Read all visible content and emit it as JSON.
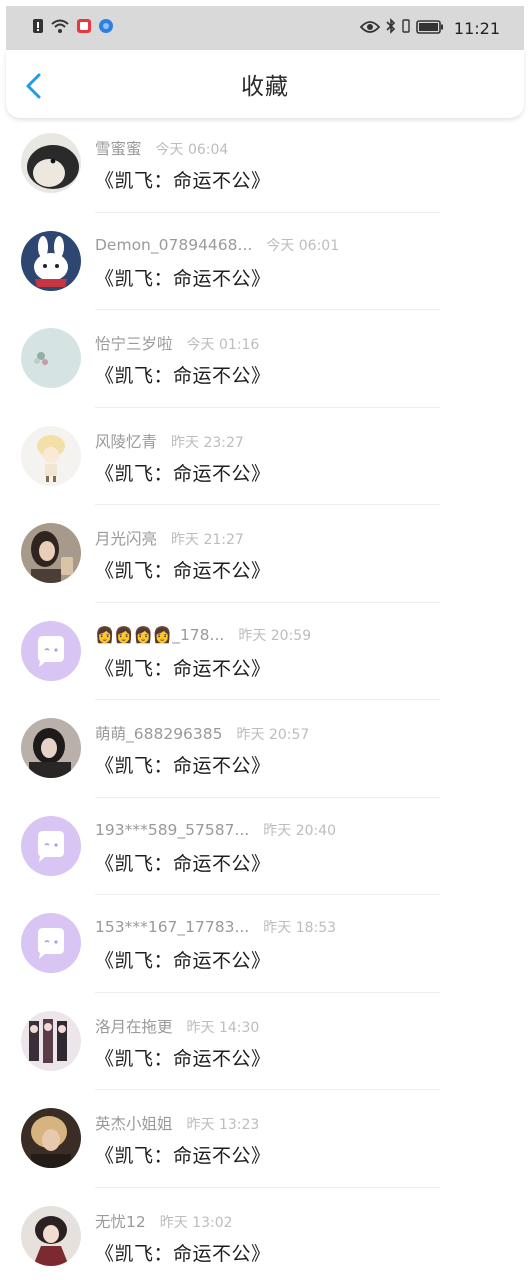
{
  "status_bar": {
    "time": "11:21",
    "left_icons": [
      "alert-icon",
      "wifi-icon",
      "app-notification-icon",
      "browser-icon"
    ],
    "right_icons": [
      "eye-icon",
      "bluetooth-icon",
      "battery-icon"
    ]
  },
  "header": {
    "title": "收藏",
    "back_icon": "chevron-left-icon"
  },
  "accent_color": "#1e9be9",
  "favorites": [
    {
      "name": "雪蜜蜜",
      "time": "今天 06:04",
      "text": "《凯飞：命运不公》",
      "avatar": "plush-toy"
    },
    {
      "name": "Demon_07894468...",
      "time": "今天 06:01",
      "text": "《凯飞：命运不公》",
      "avatar": "bunny"
    },
    {
      "name": "怡宁三岁啦",
      "time": "今天 01:16",
      "text": "《凯飞：命运不公》",
      "avatar": "flower"
    },
    {
      "name": "风陵忆青",
      "time": "昨天 23:27",
      "text": "《凯飞：命运不公》",
      "avatar": "cartoon-girl"
    },
    {
      "name": "月光闪亮",
      "time": "昨天 21:27",
      "text": "《凯飞：命运不公》",
      "avatar": "photo-girl"
    },
    {
      "name": "👩👩👩👩_178...",
      "time": "昨天 20:59",
      "text": "《凯飞：命运不公》",
      "avatar": "default-chat"
    },
    {
      "name": "萌萌_688296385",
      "time": "昨天 20:57",
      "text": "《凯飞：命运不公》",
      "avatar": "photo-dark"
    },
    {
      "name": "193***589_57587...",
      "time": "昨天 20:40",
      "text": "《凯飞：命运不公》",
      "avatar": "default-chat"
    },
    {
      "name": "153***167_17783...",
      "time": "昨天 18:53",
      "text": "《凯飞：命运不公》",
      "avatar": "default-chat"
    },
    {
      "name": "洛月在拖更",
      "time": "昨天 14:30",
      "text": "《凯飞：命运不公》",
      "avatar": "anime-group"
    },
    {
      "name": "英杰小姐姐",
      "time": "昨天 13:23",
      "text": "《凯飞：命运不公》",
      "avatar": "photo-blonde"
    },
    {
      "name": "无忧12",
      "time": "昨天 13:02",
      "text": "《凯飞：命运不公》",
      "avatar": "anime-hanfu"
    }
  ]
}
